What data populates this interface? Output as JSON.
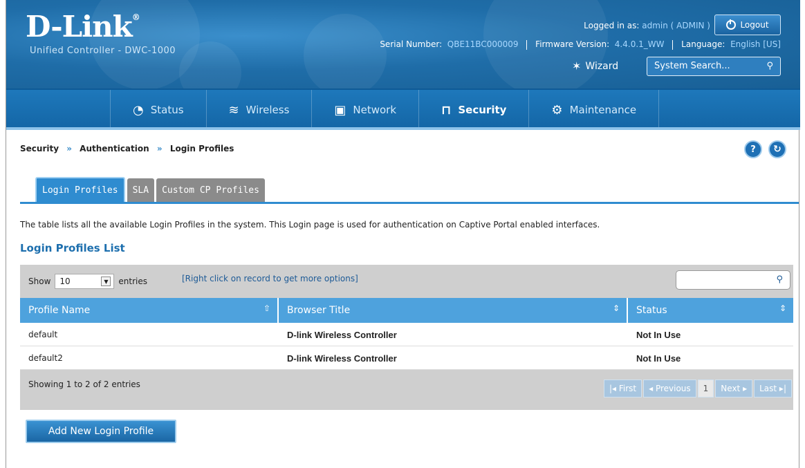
{
  "header": {
    "logo": "D-Link",
    "logo_mark": "®",
    "product": "Unified Controller - DWC-1000",
    "logged_in_label": "Logged in as:",
    "logged_in_value": "admin ( ADMIN )",
    "logout_label": "Logout",
    "serial_label": "Serial Number:",
    "serial_value": "QBE11BC000009",
    "firmware_label": "Firmware Version:",
    "firmware_value": "4.4.0.1_WW",
    "language_label": "Language:",
    "language_value": "English [US]",
    "wizard_label": "Wizard",
    "search_placeholder": "System Search..."
  },
  "nav": {
    "items": [
      {
        "label": "Status",
        "icon": "dashboard-icon"
      },
      {
        "label": "Wireless",
        "icon": "wifi-icon"
      },
      {
        "label": "Network",
        "icon": "monitor-icon"
      },
      {
        "label": "Security",
        "icon": "lock-icon"
      },
      {
        "label": "Maintenance",
        "icon": "gears-icon"
      }
    ],
    "active": "Security"
  },
  "breadcrumb": {
    "items": [
      "Security",
      "Authentication",
      "Login Profiles"
    ],
    "separator": "»"
  },
  "tabs": [
    "Login Profiles",
    "SLA",
    "Custom CP Profiles"
  ],
  "description": "The table lists all the available Login Profiles in the system. This Login page is used for authentication on Captive Portal enabled interfaces.",
  "list_title": "Login Profiles List",
  "table": {
    "show_label": "Show",
    "show_value": "10",
    "entries_label": "entries",
    "hint": "[Right click on record to get more options]",
    "columns": [
      "Profile Name",
      "Browser Title",
      "Status"
    ],
    "rows": [
      [
        "default",
        "D-link Wireless Controller",
        "Not In Use"
      ],
      [
        "default2",
        "D-link Wireless Controller",
        "Not In Use"
      ]
    ],
    "showing": "Showing 1 to 2 of 2 entries",
    "pager": {
      "first": "First",
      "previous": "Previous",
      "current": "1",
      "next": "Next",
      "last": "Last"
    }
  },
  "add_button": "Add New Login Profile",
  "colors": {
    "brand_blue": "#1f6da8",
    "nav_blue": "#1e78bb",
    "table_header": "#4ea2dd",
    "link_blue": "#1d6fae"
  }
}
